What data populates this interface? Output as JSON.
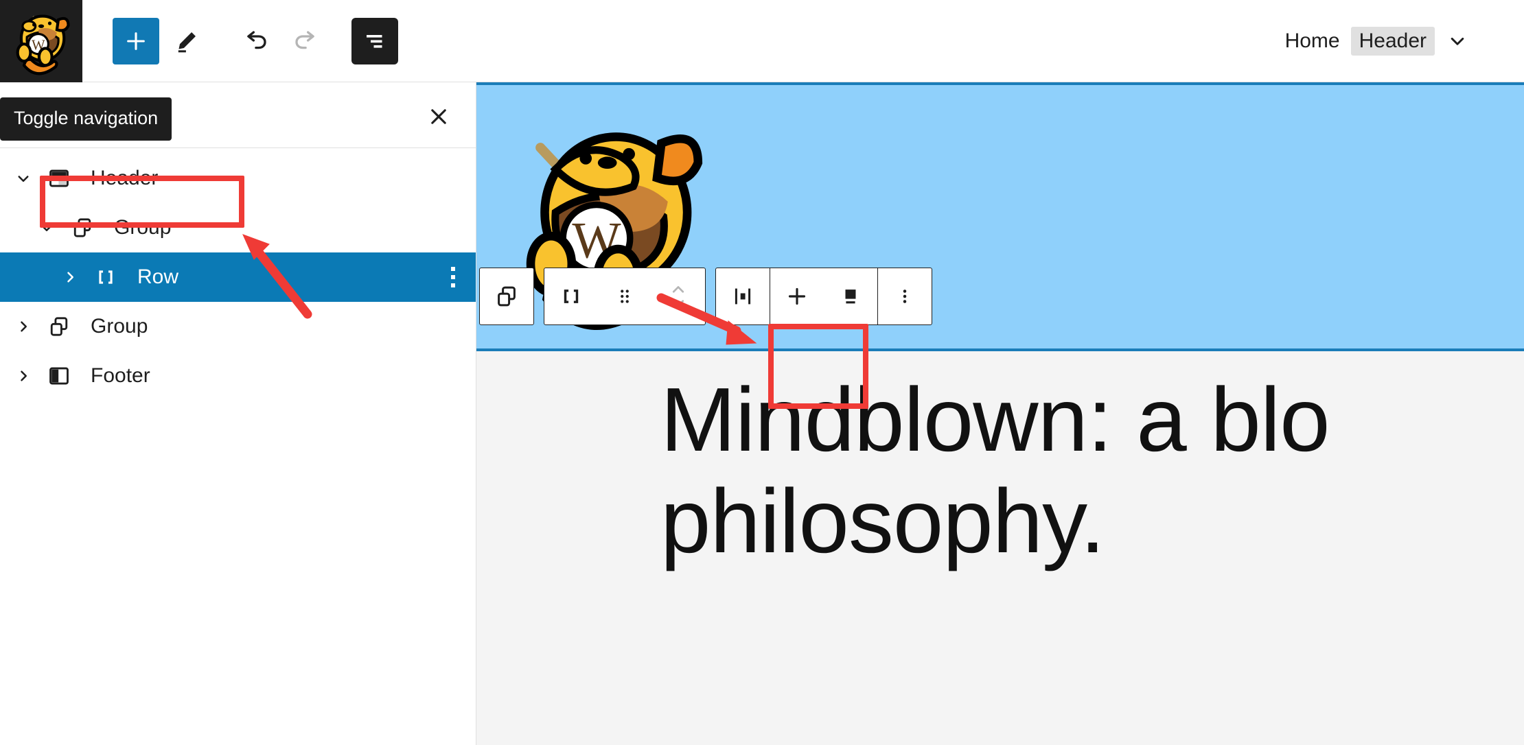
{
  "topbar": {
    "site_icon_name": "wapuu-site-icon",
    "buttons": [
      {
        "name": "add-block-button",
        "icon": "plus-icon",
        "label": "Add block",
        "state": "primary"
      },
      {
        "name": "edit-tools-button",
        "icon": "pencil-icon",
        "label": "Tools",
        "state": "default"
      },
      {
        "name": "undo-button",
        "icon": "undo-icon",
        "label": "Undo",
        "state": "enabled"
      },
      {
        "name": "redo-button",
        "icon": "redo-icon",
        "label": "Redo",
        "state": "disabled"
      },
      {
        "name": "list-view-button",
        "icon": "list-view-icon",
        "label": "List View",
        "state": "active"
      }
    ],
    "breadcrumb": {
      "home": "Home",
      "current": "Header",
      "chevron_icon": "chevron-down-icon"
    }
  },
  "listview": {
    "tooltip": "Toggle navigation",
    "close_label": "Close",
    "close_icon": "close-icon",
    "items": [
      {
        "label": "Header",
        "icon": "header-block-icon",
        "indent": 0,
        "twisty": "chevron-down-icon",
        "expanded": true,
        "selected": false
      },
      {
        "label": "Group",
        "icon": "group-block-icon",
        "indent": 1,
        "twisty": "chevron-down-icon",
        "expanded": true,
        "selected": false
      },
      {
        "label": "Row",
        "icon": "row-block-icon",
        "indent": 2,
        "twisty": "chevron-right-icon",
        "expanded": false,
        "selected": true
      },
      {
        "label": "Group",
        "icon": "group-block-icon",
        "indent": 0,
        "twisty": "chevron-right-icon",
        "expanded": false,
        "selected": false
      },
      {
        "label": "Footer",
        "icon": "footer-block-icon",
        "indent": 0,
        "twisty": "chevron-right-icon",
        "expanded": false,
        "selected": false
      }
    ],
    "row_options_label": "Options"
  },
  "canvas": {
    "hero": {
      "background_color": "#8fd0fb",
      "selection_border_color": "#1a7cb8",
      "image_name": "wapuu-mascot-image"
    },
    "post_title_line1": "Mindblown: a blo",
    "post_title_line2": "philosophy."
  },
  "block_toolbar": {
    "buttons": [
      {
        "name": "block-type-group-button",
        "icon": "group-block-icon",
        "label": "Group"
      },
      {
        "name": "parent-row-button",
        "icon": "row-block-icon",
        "label": "Select Row"
      },
      {
        "name": "drag-handle",
        "icon": "drag-dots-icon",
        "label": "Drag"
      },
      {
        "name": "move-updown-button",
        "icon": "move-arrows-icon",
        "label": "Move up or down"
      },
      {
        "name": "justify-items-button",
        "icon": "justify-center-icon",
        "label": "Change items justification"
      },
      {
        "name": "add-inner-block-button",
        "icon": "plus-icon",
        "label": "Add block"
      },
      {
        "name": "block-position-button",
        "icon": "block-position-icon",
        "label": "Position",
        "highlighted": true
      },
      {
        "name": "more-options-button",
        "icon": "ellipsis-vertical-icon",
        "label": "Options"
      }
    ]
  },
  "annotations": {
    "accent_color": "#ef3b36",
    "box_row_label": "highlight-row-list-item",
    "box_toolbar_label": "highlight-position-toolbar-button",
    "arrow_sidebar_label": "arrow-pointing-to-row",
    "arrow_toolbar_label": "arrow-pointing-to-toolbar"
  }
}
